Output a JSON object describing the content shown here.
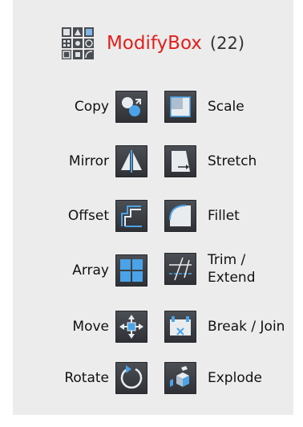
{
  "header": {
    "title": "ModifyBox",
    "count": "(22)",
    "logo_icon": "toolbox-grid-icon"
  },
  "colors": {
    "title": "#e0201d",
    "panel": "#ececec",
    "tile": "#3a3d42",
    "icon_blue": "#4aa3e8"
  },
  "tools": {
    "copy": {
      "label": "Copy",
      "icon": "copy-icon"
    },
    "scale": {
      "label": "Scale",
      "icon": "scale-icon"
    },
    "mirror": {
      "label": "Mirror",
      "icon": "mirror-icon"
    },
    "stretch": {
      "label": "Stretch",
      "icon": "stretch-icon"
    },
    "offset": {
      "label": "Offset",
      "icon": "offset-icon"
    },
    "fillet": {
      "label": "Fillet",
      "icon": "fillet-icon"
    },
    "array": {
      "label": "Array",
      "icon": "array-icon"
    },
    "trim": {
      "label_line1": "Trim /",
      "label_line2": "Extend",
      "icon": "trim-extend-icon"
    },
    "move": {
      "label": "Move",
      "icon": "move-icon"
    },
    "break": {
      "label": "Break / Join",
      "icon": "break-join-icon"
    },
    "rotate": {
      "label": "Rotate",
      "icon": "rotate-icon"
    },
    "explode": {
      "label": "Explode",
      "icon": "explode-icon"
    }
  }
}
